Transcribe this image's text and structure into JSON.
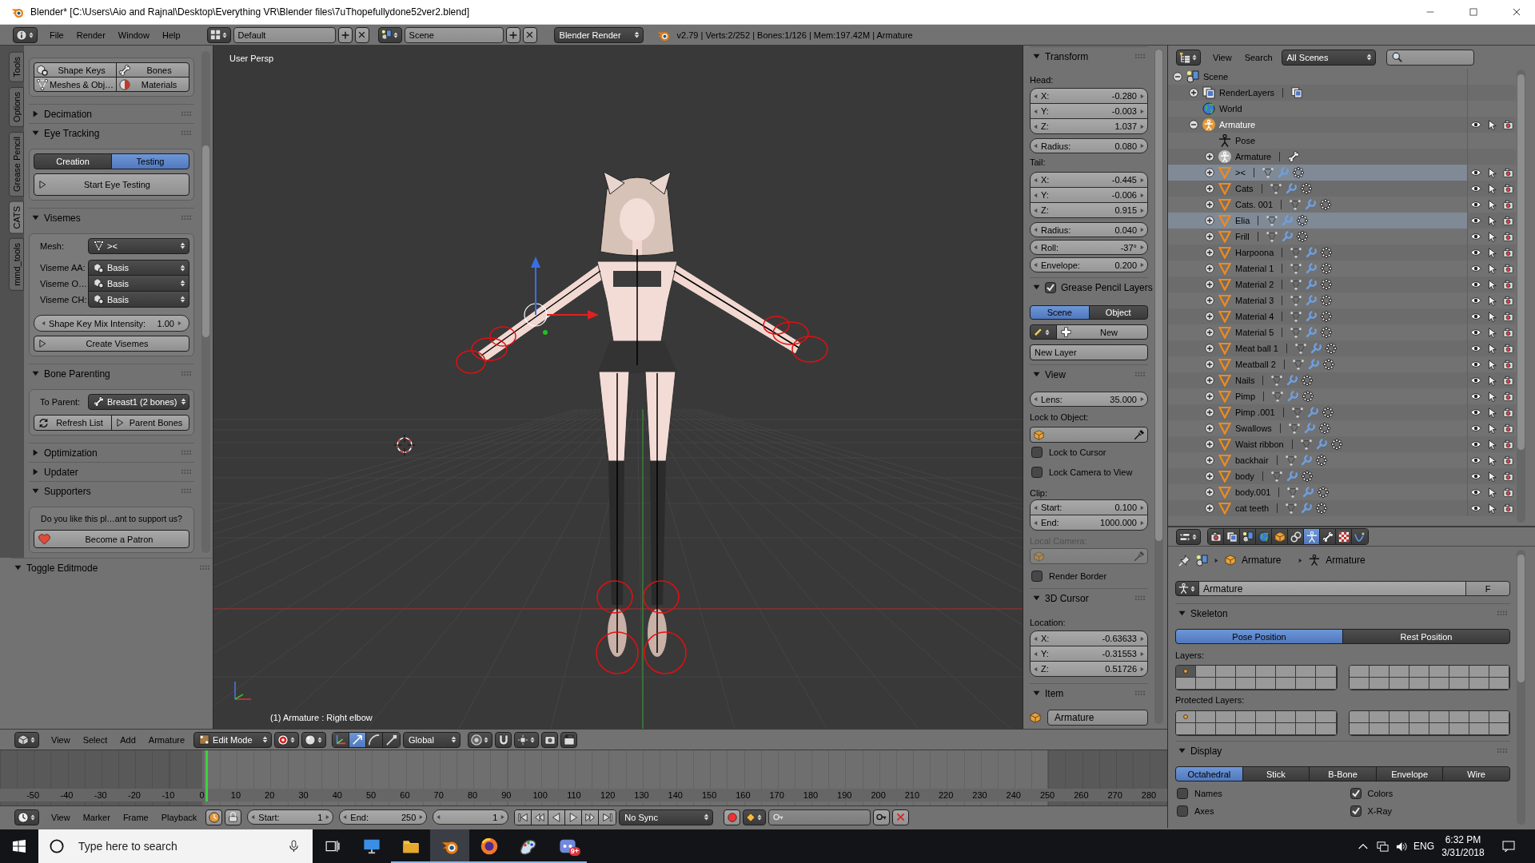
{
  "window": {
    "title": "Blender* [C:\\Users\\Aio and Rajnal\\Desktop\\Everything VR\\Blender files\\7uThopefullydone52ver2.blend]"
  },
  "info_header": {
    "menus": [
      "File",
      "Render",
      "Window",
      "Help"
    ],
    "screen_layout": "Default",
    "scene": "Scene",
    "render_engine": "Blender Render",
    "stats": "v2.79 | Verts:2/252 | Bones:1/126 | Mem:197.42M | Armature"
  },
  "tool_tabs": [
    {
      "label": "Tools",
      "selected": false
    },
    {
      "label": "Options",
      "selected": false
    },
    {
      "label": "Grease Pencil",
      "selected": false
    },
    {
      "label": "CATS",
      "selected": true
    },
    {
      "label": "mmd_tools",
      "selected": false
    }
  ],
  "tool_shelf": {
    "quick_buttons": [
      {
        "label": "Shape Keys",
        "kind": "shape_keys"
      },
      {
        "label": "Bones",
        "kind": "bone"
      },
      {
        "label": "Meshes & Obj…",
        "kind": "mesh"
      },
      {
        "label": "Materials",
        "kind": "material"
      }
    ],
    "panels": [
      {
        "title": "Decimation",
        "expanded": false
      },
      {
        "kind": "eye_tracking",
        "title": "Eye Tracking",
        "expanded": true,
        "modes": [
          {
            "label": "Creation",
            "selected": false
          },
          {
            "label": "Testing",
            "selected": true
          }
        ],
        "action": "Start Eye Testing"
      },
      {
        "kind": "visemes",
        "title": "Visemes",
        "expanded": true,
        "mesh": {
          "label": "Mesh:",
          "value": "><"
        },
        "visemes": [
          {
            "label": "Viseme AA:",
            "value": "Basis"
          },
          {
            "label": "Viseme O…",
            "value": "Basis"
          },
          {
            "label": "Viseme CH:",
            "value": "Basis"
          }
        ],
        "intensity": {
          "label": "Shape Key Mix Intensity:",
          "value": "1.00"
        },
        "action": "Create Visemes"
      },
      {
        "kind": "bone_parenting",
        "title": "Bone Parenting",
        "expanded": true,
        "to_parent": {
          "label": "To Parent:",
          "value": "Breast1 (2 bones)"
        },
        "actions": [
          "Refresh List",
          "Parent Bones"
        ]
      },
      {
        "title": "Optimization",
        "expanded": false
      },
      {
        "title": "Updater",
        "expanded": false
      },
      {
        "kind": "supporters",
        "title": "Supporters",
        "expanded": true,
        "message": "Do you like this pl…ant to support us?",
        "action": "Become a Patron"
      }
    ],
    "toggle_editmode": {
      "title": "Toggle Editmode",
      "expanded": true
    }
  },
  "viewport": {
    "view_name": "User Persp",
    "status": "(1) Armature : Right elbow"
  },
  "n_panel": {
    "transform": {
      "title": "Transform",
      "expanded": true,
      "head_label": "Head:",
      "head": [
        {
          "label": "X:",
          "value": "-0.280"
        },
        {
          "label": "Y:",
          "value": "-0.003"
        },
        {
          "label": "Z:",
          "value": "1.037"
        }
      ],
      "head_radius": {
        "label": "Radius:",
        "value": "0.080"
      },
      "tail_label": "Tail:",
      "tail": [
        {
          "label": "X:",
          "value": "-0.445"
        },
        {
          "label": "Y:",
          "value": "-0.006"
        },
        {
          "label": "Z:",
          "value": "0.915"
        }
      ],
      "tail_props": [
        {
          "label": "Radius:",
          "value": "0.040"
        },
        {
          "label": "Roll:",
          "value": "-37°"
        },
        {
          "label": "Envelope:",
          "value": "0.200"
        }
      ]
    },
    "grease_pencil": {
      "title": "Grease Pencil Layers",
      "checked": true,
      "expanded": true,
      "sources": [
        {
          "label": "Scene",
          "selected": true
        },
        {
          "label": "Object",
          "selected": false
        }
      ],
      "new_button": "New",
      "new_layer_button": "New Layer"
    },
    "view": {
      "title": "View",
      "expanded": true,
      "lens": {
        "label": "Lens:",
        "value": "35.000"
      },
      "lock_label": "Lock to Object:",
      "locks": [
        {
          "label": "Lock to Cursor",
          "checked": false
        },
        {
          "label": "Lock Camera to View",
          "checked": false
        }
      ],
      "clip_label": "Clip:",
      "clip": [
        {
          "label": "Start:",
          "value": "0.100"
        },
        {
          "label": "End:",
          "value": "1000.000"
        }
      ],
      "local_camera": {
        "label": "Local Camera:",
        "disabled": true
      },
      "render_border": {
        "label": "Render Border",
        "checked": false
      }
    },
    "cursor": {
      "title": "3D Cursor",
      "expanded": true,
      "location_label": "Location:",
      "location": [
        {
          "label": "X:",
          "value": "-0.63633"
        },
        {
          "label": "Y:",
          "value": "-0.31553"
        },
        {
          "label": "Z:",
          "value": "0.51726"
        }
      ]
    },
    "item": {
      "title": "Item",
      "expanded": true,
      "name": "Armature"
    }
  },
  "outliner": {
    "menus": [
      "View",
      "Search"
    ],
    "filter": "All Scenes",
    "tree": [
      {
        "label": "Scene",
        "kind": "scene",
        "expanded": true,
        "selected": false,
        "active": false,
        "children": [
          {
            "label": "RenderLayers",
            "kind": "render_layers",
            "expanded": false,
            "selected": false,
            "active": false
          },
          {
            "label": "World",
            "kind": "world",
            "selected": false,
            "active": false
          },
          {
            "label": "Armature",
            "kind": "armature_object",
            "expanded": true,
            "selected": false,
            "active": true,
            "children": [
              {
                "label": "Pose",
                "kind": "pose",
                "selected": false,
                "active": false
              },
              {
                "label": "Armature",
                "kind": "armature_data",
                "expanded": false,
                "selected": false,
                "active": false
              },
              {
                "label": "><",
                "kind": "mesh",
                "expanded": false,
                "selected": true,
                "active": false
              },
              {
                "label": "Cats",
                "kind": "mesh",
                "expanded": false,
                "selected": false,
                "active": false
              },
              {
                "label": "Cats. 001",
                "kind": "mesh",
                "expanded": false,
                "selected": false,
                "active": false
              },
              {
                "label": "Elia",
                "kind": "mesh",
                "expanded": false,
                "selected": true,
                "active": false
              },
              {
                "label": "Frill",
                "kind": "mesh",
                "expanded": false,
                "selected": false,
                "active": false
              },
              {
                "label": "Harpoona",
                "kind": "mesh",
                "expanded": false,
                "selected": false,
                "active": false
              },
              {
                "label": "Material 1",
                "kind": "mesh",
                "expanded": false,
                "selected": false,
                "active": false
              },
              {
                "label": "Material 2",
                "kind": "mesh",
                "expanded": false,
                "selected": false,
                "active": false
              },
              {
                "label": "Material 3",
                "kind": "mesh",
                "expanded": false,
                "selected": false,
                "active": false
              },
              {
                "label": "Material 4",
                "kind": "mesh",
                "expanded": false,
                "selected": false,
                "active": false
              },
              {
                "label": "Material 5",
                "kind": "mesh",
                "expanded": false,
                "selected": false,
                "active": false
              },
              {
                "label": "Meat ball 1",
                "kind": "mesh",
                "expanded": false,
                "selected": false,
                "active": false
              },
              {
                "label": "Meatball 2",
                "kind": "mesh",
                "expanded": false,
                "selected": false,
                "active": false
              },
              {
                "label": "Nails",
                "kind": "mesh",
                "expanded": false,
                "selected": false,
                "active": false
              },
              {
                "label": "Pimp",
                "kind": "mesh",
                "expanded": false,
                "selected": false,
                "active": false
              },
              {
                "label": "Pimp .001",
                "kind": "mesh",
                "expanded": false,
                "selected": false,
                "active": false
              },
              {
                "label": "Swallows",
                "kind": "mesh",
                "expanded": false,
                "selected": false,
                "active": false
              },
              {
                "label": "Waist ribbon",
                "kind": "mesh",
                "expanded": false,
                "selected": false,
                "active": false
              },
              {
                "label": "backhair",
                "kind": "mesh",
                "expanded": false,
                "selected": false,
                "active": false
              },
              {
                "label": "body",
                "kind": "mesh",
                "expanded": false,
                "selected": false,
                "active": false
              },
              {
                "label": "body.001",
                "kind": "mesh",
                "expanded": false,
                "selected": false,
                "active": false
              },
              {
                "label": "cat teeth",
                "kind": "mesh",
                "expanded": false,
                "selected": false,
                "active": false
              }
            ]
          }
        ]
      }
    ]
  },
  "properties": {
    "tabs": [
      {
        "kind": "render",
        "selected": false
      },
      {
        "kind": "render_layers",
        "selected": false
      },
      {
        "kind": "scene",
        "selected": false
      },
      {
        "kind": "world",
        "selected": false
      },
      {
        "kind": "object",
        "selected": false
      },
      {
        "kind": "constraints",
        "selected": false
      },
      {
        "kind": "armature_data",
        "selected": true
      },
      {
        "kind": "bone",
        "selected": false
      },
      {
        "kind": "texture",
        "selected": false
      },
      {
        "kind": "physics",
        "selected": false
      }
    ],
    "breadcrumb": [
      {
        "label": "Armature",
        "kind": "object"
      },
      {
        "label": "Armature",
        "kind": "armature"
      }
    ],
    "datablock": {
      "name": "Armature",
      "fake_user": "F"
    },
    "skeleton": {
      "title": "Skeleton",
      "expanded": true,
      "positions": [
        {
          "label": "Pose Position",
          "selected": true
        },
        {
          "label": "Rest Position",
          "selected": false
        }
      ],
      "layers": {
        "label": "Layers:",
        "selected": [
          true,
          false,
          false,
          false,
          false,
          false,
          false,
          false,
          false,
          false,
          false,
          false,
          false,
          false,
          false,
          false,
          false,
          false,
          false,
          false,
          false,
          false,
          false,
          false,
          false,
          false,
          false,
          false,
          false,
          false,
          false,
          false
        ],
        "has_bones": [
          true,
          false,
          false,
          false,
          false,
          false,
          false,
          false,
          false,
          false,
          false,
          false,
          false,
          false,
          false,
          false,
          false,
          false,
          false,
          false,
          false,
          false,
          false,
          false,
          false,
          false,
          false,
          false,
          false,
          false,
          false,
          false
        ]
      },
      "protected_layers": {
        "label": "Protected Layers:",
        "selected": [
          false,
          false,
          false,
          false,
          false,
          false,
          false,
          false,
          false,
          false,
          false,
          false,
          false,
          false,
          false,
          false,
          false,
          false,
          false,
          false,
          false,
          false,
          false,
          false,
          false,
          false,
          false,
          false,
          false,
          false,
          false,
          false
        ],
        "has_bones": [
          true,
          false,
          false,
          false,
          false,
          false,
          false,
          false,
          false,
          false,
          false,
          false,
          false,
          false,
          false,
          false,
          false,
          false,
          false,
          false,
          false,
          false,
          false,
          false,
          false,
          false,
          false,
          false,
          false,
          false,
          false,
          false
        ]
      }
    },
    "display": {
      "title": "Display",
      "expanded": true,
      "draw_types": [
        {
          "label": "Octahedral",
          "selected": true
        },
        {
          "label": "Stick",
          "selected": false
        },
        {
          "label": "B-Bone",
          "selected": false
        },
        {
          "label": "Envelope",
          "selected": false
        },
        {
          "label": "Wire",
          "selected": false
        }
      ],
      "options": [
        {
          "label": "Names",
          "checked": false
        },
        {
          "label": "Colors",
          "checked": true
        },
        {
          "label": "Axes",
          "checked": false
        },
        {
          "label": "X-Ray",
          "checked": true
        }
      ]
    }
  },
  "viewport_header": {
    "menus": [
      "View",
      "Select",
      "Add",
      "Armature"
    ],
    "mode": "Edit Mode",
    "manipulators": [
      {
        "kind": "axes",
        "selected": false
      },
      {
        "kind": "translate",
        "selected": true
      },
      {
        "kind": "rotate",
        "selected": false
      },
      {
        "kind": "scale",
        "selected": false
      }
    ],
    "orientation": "Global"
  },
  "timeline": {
    "ruler": [
      "-50",
      "-40",
      "-30",
      "-20",
      "-10",
      "0",
      "10",
      "20",
      "30",
      "40",
      "50",
      "60",
      "70",
      "80",
      "90",
      "100",
      "110",
      "120",
      "130",
      "140",
      "150",
      "160",
      "170",
      "180",
      "190",
      "200",
      "210",
      "220",
      "230",
      "240",
      "250",
      "260",
      "270",
      "280"
    ],
    "header": {
      "menus": [
        "View",
        "Marker",
        "Frame",
        "Playback"
      ],
      "start": {
        "label": "Start:",
        "value": "1"
      },
      "end": {
        "label": "End:",
        "value": "250"
      },
      "current": "1",
      "sync": "No Sync"
    }
  },
  "taskbar": {
    "search": {
      "placeholder": "Type here to search"
    },
    "apps": [
      {
        "kind": "desktop",
        "selected": false,
        "running": false
      },
      {
        "kind": "folder",
        "selected": false,
        "running": true
      },
      {
        "kind": "blender",
        "selected": true,
        "running": true
      },
      {
        "kind": "browser",
        "selected": false,
        "running": true
      },
      {
        "kind": "paint",
        "selected": false,
        "running": true
      },
      {
        "kind": "chat",
        "selected": false,
        "running": true,
        "badge": "9+"
      }
    ],
    "language": "ENG",
    "time": "6:32 PM",
    "date": "3/31/2018"
  }
}
